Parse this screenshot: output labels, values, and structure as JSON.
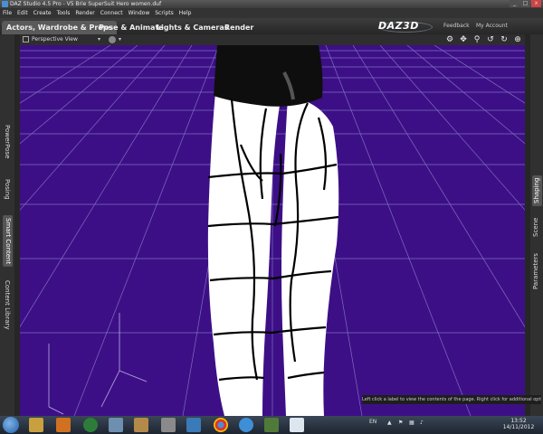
{
  "window": {
    "title": "DAZ Studio 4.5 Pro - V5 Brie SuperSuit Hero women.duf",
    "minimize": "_",
    "maximize": "□",
    "close": "x"
  },
  "menu": [
    "File",
    "Edit",
    "Create",
    "Tools",
    "Render",
    "Connect",
    "Window",
    "Scripts",
    "Help"
  ],
  "tabs": [
    {
      "label": "Actors, Wardrobe & Props",
      "active": true
    },
    {
      "label": "Pose & Animate"
    },
    {
      "label": "Lights & Cameras"
    },
    {
      "label": "Render"
    }
  ],
  "header": {
    "brand": "DAZ3D",
    "feedback": "Feedback",
    "my_account": "My Account"
  },
  "viewport": {
    "camera": "Perspective View",
    "chevron": "▾",
    "background_color": "#3d0f86",
    "grid_color": "#8a7fc4",
    "nav_icons": [
      "camera-icon",
      "pan-icon",
      "zoom-icon",
      "orbit-icon",
      "rotate-icon",
      "frame-icon"
    ]
  },
  "left_tabs": [
    {
      "label": "PowerPose"
    },
    {
      "label": "Posing"
    },
    {
      "label": "Smart Content",
      "active": true
    },
    {
      "label": "Content Library"
    }
  ],
  "right_tabs": [
    {
      "label": "Shaping",
      "active": true
    },
    {
      "label": "Scene"
    },
    {
      "label": "Parameters"
    }
  ],
  "status": {
    "tooltip": "Left click a label to view the contents of the page. Right click for additional options"
  },
  "taskbar": {
    "lang": "EN",
    "time": "13:52",
    "date": "14/11/2012",
    "items": [
      "start-button",
      "explorer-icon",
      "media-player-icon",
      "media-center-icon",
      "control-panel-icon",
      "daz-studio-icon",
      "hexagon-icon",
      "bryce-icon",
      "chrome-icon",
      "internet-explorer-icon",
      "game-icon",
      "notepad-icon"
    ]
  }
}
